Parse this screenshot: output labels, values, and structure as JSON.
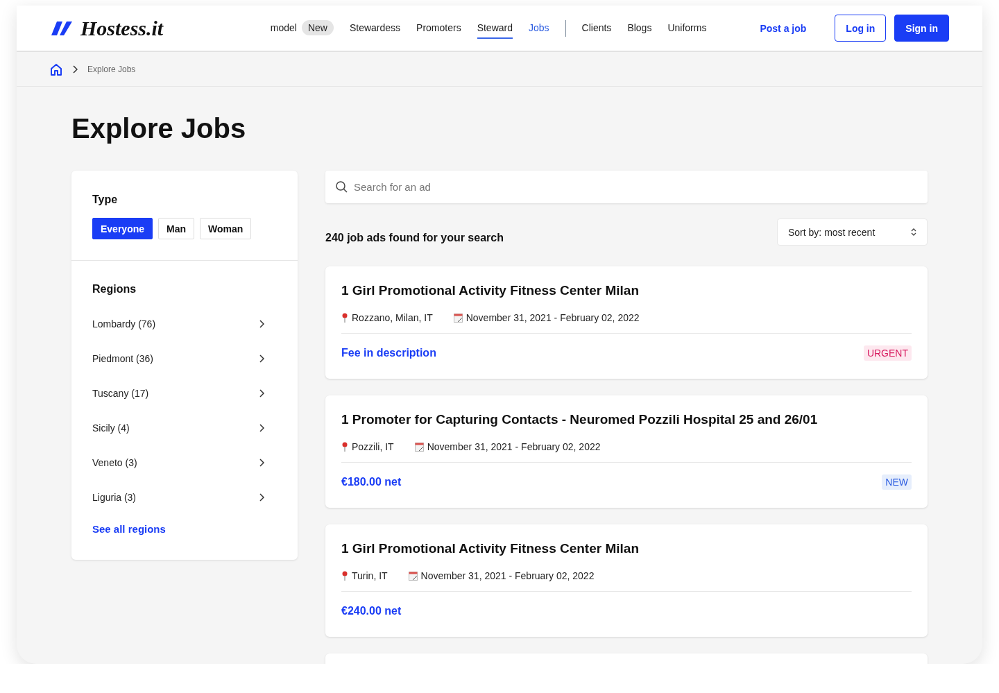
{
  "brand": {
    "name": "Hostess.it"
  },
  "nav": [
    {
      "label": "model",
      "selected": false,
      "focused": false,
      "badge": "New"
    },
    {
      "label": "Stewardess",
      "selected": false,
      "focused": false
    },
    {
      "label": "Promoters",
      "selected": false,
      "focused": false
    },
    {
      "label": "Steward",
      "selected": false,
      "focused": true
    },
    {
      "label": "Jobs",
      "selected": true,
      "focused": false
    },
    {
      "label": "Clients",
      "selected": false,
      "focused": false
    },
    {
      "label": "Blogs",
      "selected": false,
      "focused": false
    },
    {
      "label": "Uniforms",
      "selected": false,
      "focused": false
    }
  ],
  "actions": [
    {
      "label": "Post a job",
      "kind": "link"
    },
    {
      "label": "Log in",
      "kind": "outline"
    },
    {
      "label": "Sign in",
      "kind": "primary"
    }
  ],
  "breadcrumb": [
    "Explore Jobs"
  ],
  "page_title": "Explore Jobs",
  "filters": {
    "type_title": "Type",
    "types": [
      {
        "label": "Everyone",
        "selected": true
      },
      {
        "label": "Man",
        "selected": false
      },
      {
        "label": "Woman",
        "selected": false
      }
    ],
    "regions_title": "Regions",
    "regions": [
      "Lombardy (76)",
      "Piedmont (36)",
      "Tuscany (17)",
      "Sicily (4)",
      "Veneto (3)",
      "Liguria (3)"
    ],
    "see_all": "See all regions"
  },
  "search": {
    "placeholder": "Search for an ad"
  },
  "results_count": "240 job ads found for your search",
  "sort": {
    "value": "Sort by: most recent"
  },
  "jobs": [
    {
      "kind": "full",
      "title": "1 Girl Promotional Activity Fitness Center Milan",
      "location": "Rozzano, Milan, IT",
      "dates": "November 31, 2021 - February 02, 2022",
      "pay": "Fee in description",
      "tag": {
        "label": "URGENT",
        "kind": "urgent"
      }
    },
    {
      "kind": "full",
      "title": "1 Promoter for Capturing Contacts - Neuromed Pozzili Hospital 25 and 26/01",
      "location": "Pozzili, IT",
      "dates": "November 31, 2021 - February 02, 2022",
      "pay": "€180.00 net",
      "tag": {
        "label": "NEW",
        "kind": "new"
      }
    },
    {
      "kind": "full",
      "title": "1 Girl Promotional Activity Fitness Center Milan",
      "location": "Turin, IT",
      "dates": "November 31, 2021 - February 02, 2022",
      "pay": "€240.00 net"
    },
    {
      "kind": "cut"
    }
  ]
}
